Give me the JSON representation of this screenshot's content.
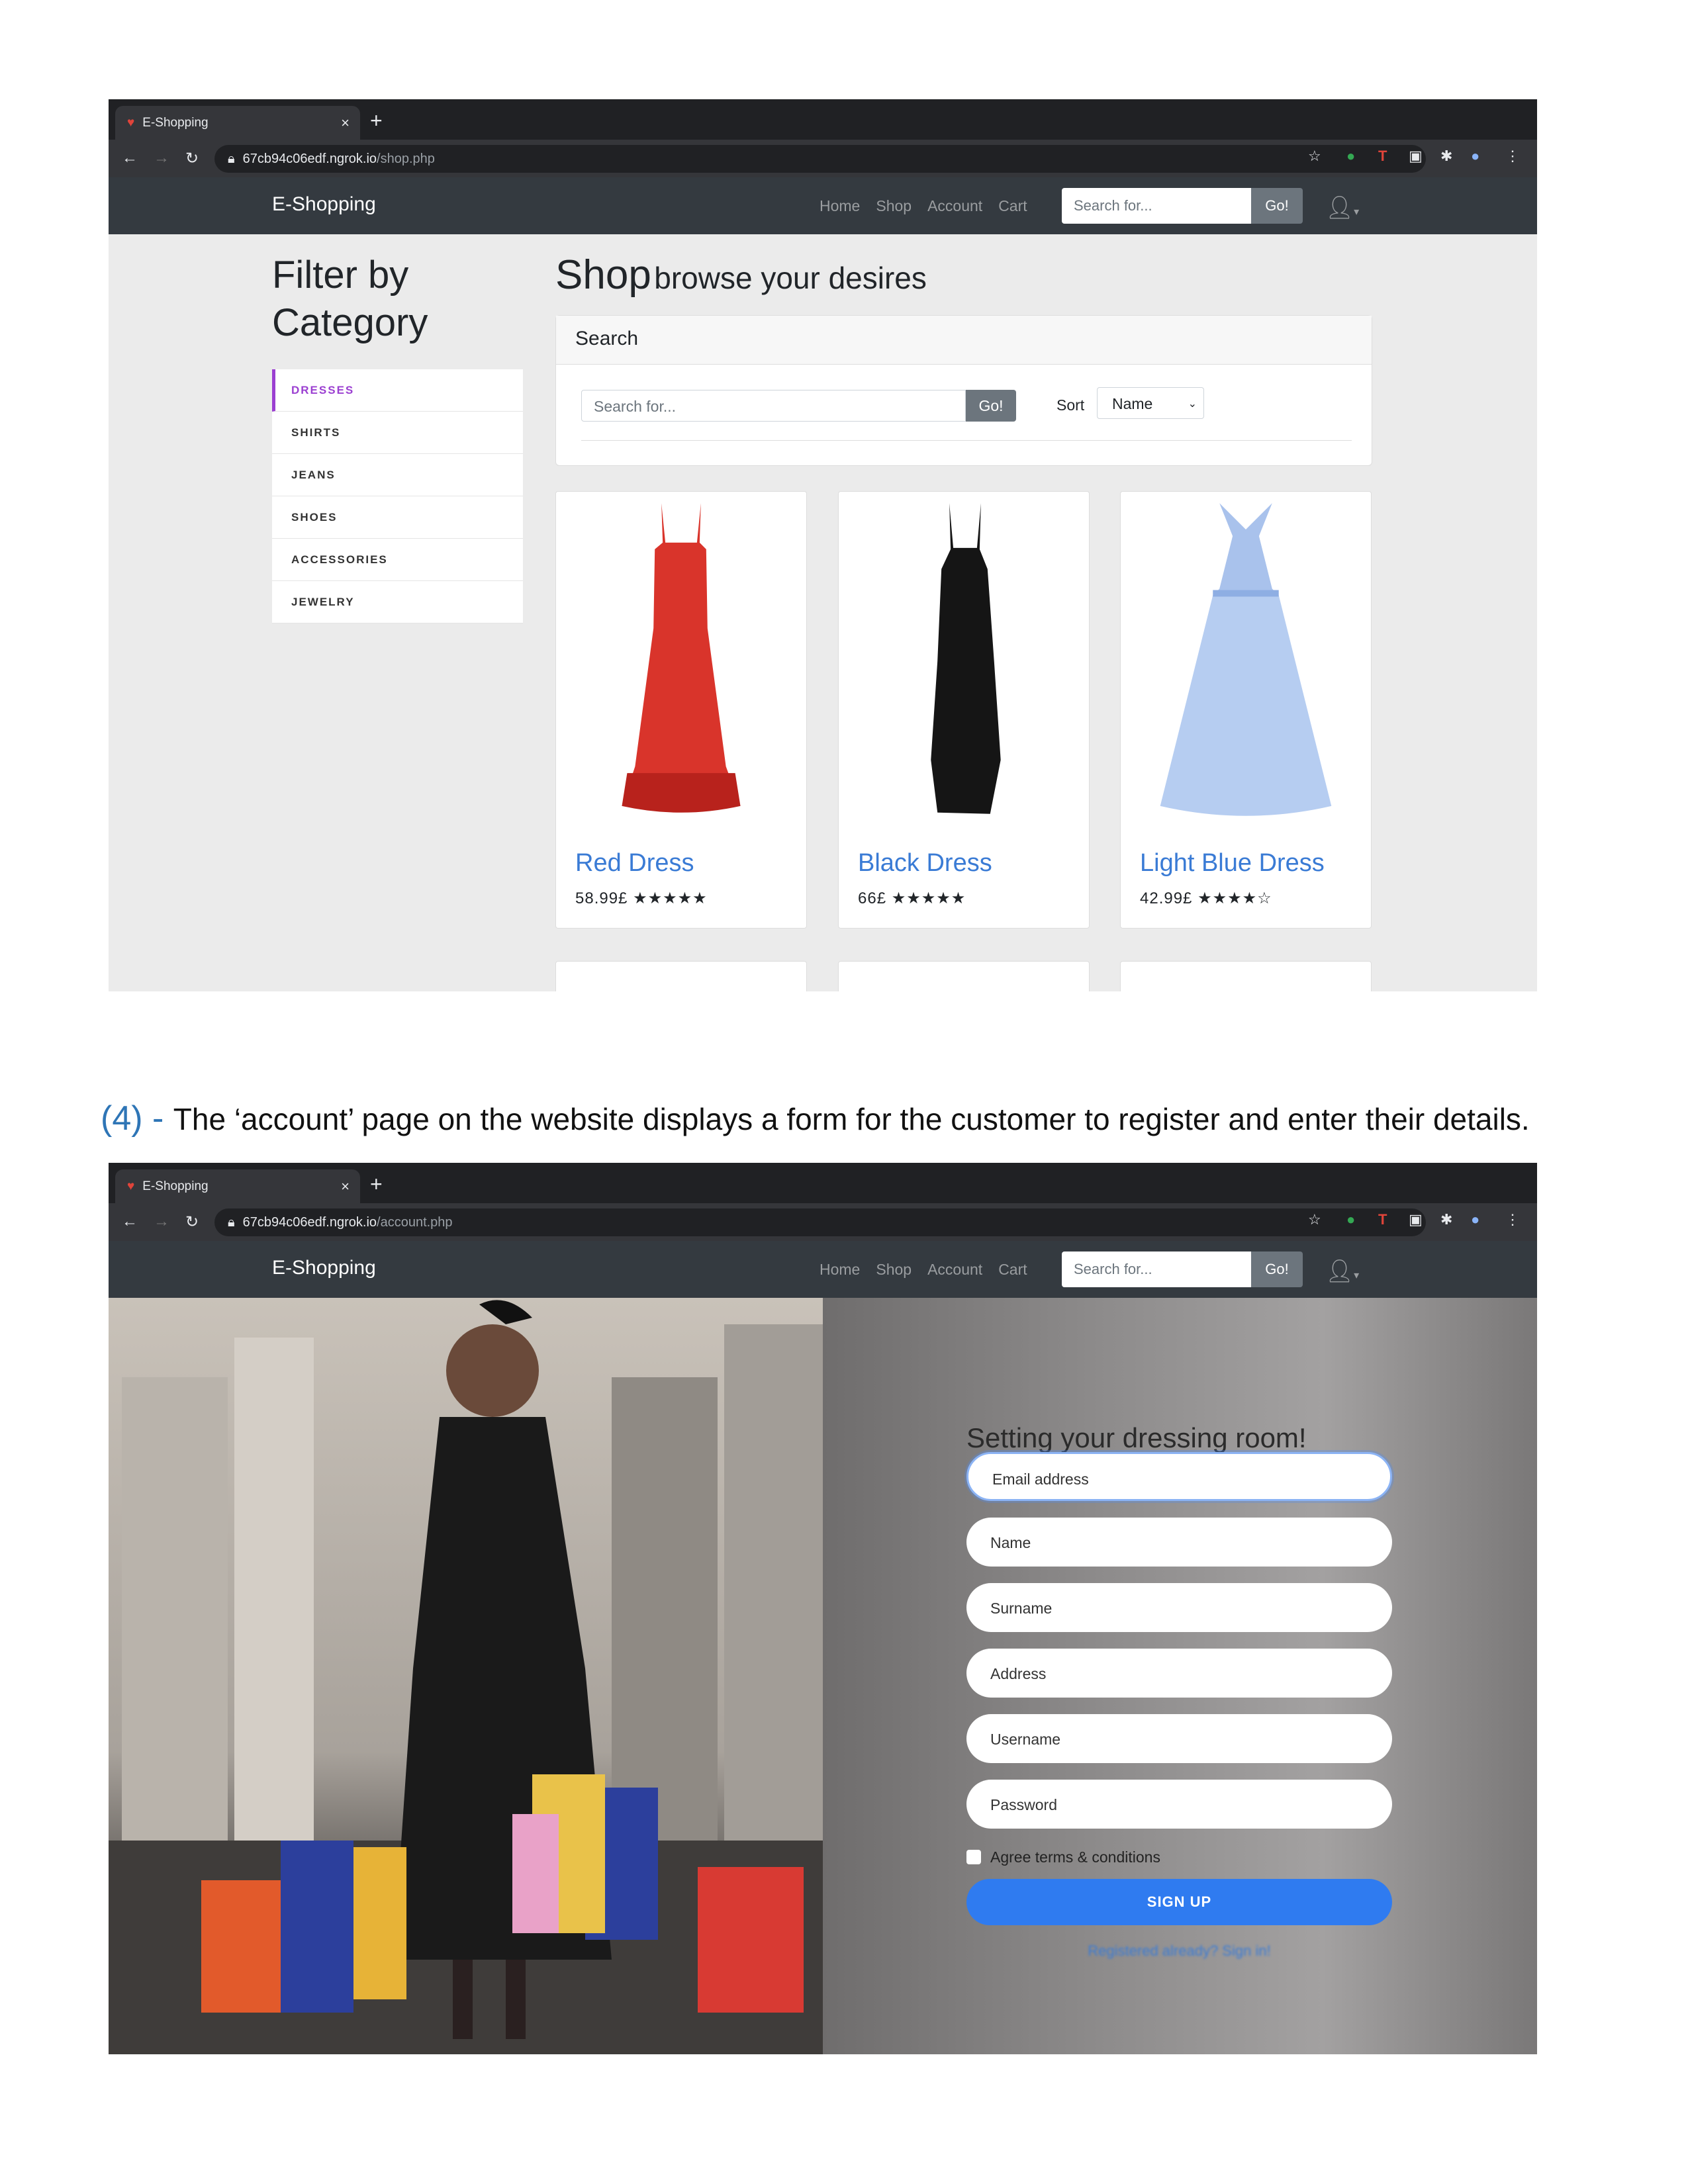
{
  "browser": {
    "tab_title": "E-Shopping",
    "url_host": "67cb94c06edf.ngrok.io",
    "shop_path": "/shop.php",
    "account_path": "/account.php"
  },
  "navbar": {
    "brand": "E-Shopping",
    "links": [
      "Home",
      "Shop",
      "Account",
      "Cart"
    ],
    "search_placeholder": "Search for...",
    "go": "Go!"
  },
  "shop": {
    "filter_title_1": "Filter by",
    "filter_title_2": "Category",
    "categories": [
      "DRESSES",
      "SHIRTS",
      "JEANS",
      "SHOES",
      "ACCESSORIES",
      "JEWELRY"
    ],
    "active_category": "DRESSES",
    "title": "Shop",
    "subtitle": "browse your desires",
    "search_header": "Search",
    "search_placeholder": "Search for...",
    "go": "Go!",
    "sort_label": "Sort",
    "sort_value": "Name",
    "products": [
      {
        "name": "Red Dress",
        "price": "58.99£",
        "stars": "★★★★★",
        "rating": 5,
        "color": "#d9342b"
      },
      {
        "name": "Black Dress",
        "price": "66£",
        "stars": "★★★★★",
        "rating": 5,
        "color": "#151515"
      },
      {
        "name": "Light Blue Dress",
        "price": "42.99£",
        "stars": "★★★★☆",
        "rating": 4,
        "color": "#a9c2ec"
      }
    ]
  },
  "caption": {
    "num": "(4)",
    "dash": " - ",
    "text": "The ‘account’ page on the website displays a form for the customer to register and enter their details."
  },
  "account": {
    "title": "Setting your dressing room!",
    "fields": [
      "Email address",
      "Name",
      "Surname",
      "Address",
      "Username",
      "Password"
    ],
    "agree": "Agree terms & conditions",
    "signup": "SIGN UP",
    "signin_link": "Registered already? Sign in!"
  }
}
